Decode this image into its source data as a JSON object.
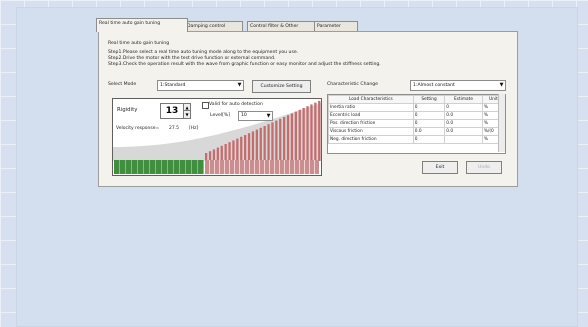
{
  "tabs": [
    {
      "label": "Real time auto gain tuning"
    },
    {
      "label": "Damping control"
    },
    {
      "label": "Control filter & Other"
    },
    {
      "label": "Parameter"
    }
  ],
  "panel": {
    "title": "Real time auto gain tuning",
    "step1": "Step1.Please select a real time auto tuning mode along to the equipment you use.",
    "step2": "Step2.Drive the motor with the test drive function or external command.",
    "step3": "Step3.Check the operation result with the wave from graphic function or easy monitor and adjust the stiffness setting."
  },
  "controls": {
    "select_mode_label": "Select Mode",
    "select_mode_value": "1:Standard",
    "customize_button": "Customize Setting",
    "characteristic_label": "Characteristic Change",
    "characteristic_value": "1:Almost constant"
  },
  "tuning": {
    "rigidity_label": "Rigidity",
    "rigidity_value": "13",
    "valid_label": "Valid for auto detection",
    "level_label": "Level[%]",
    "level_value": "10",
    "velocity_label": "Velocity response=",
    "velocity_value": "27.5",
    "velocity_unit": "[Hz]"
  },
  "table": {
    "headers": [
      "Load Characteristics",
      "Setting",
      "Estimate",
      "Unit"
    ],
    "rows": [
      [
        "Inertia ratio",
        "0",
        "0",
        "%"
      ],
      [
        "Eccentric load",
        "0",
        "0.0",
        "%"
      ],
      [
        "Pos. direction friction",
        "0",
        "0.0",
        "%"
      ],
      [
        "Viscous friction",
        "0.0",
        "0.0",
        "%/(0"
      ],
      [
        "Neg. direction friction",
        "0",
        "",
        "%"
      ]
    ]
  },
  "buttons": {
    "exit": "Exit",
    "unknown": "Undo"
  }
}
